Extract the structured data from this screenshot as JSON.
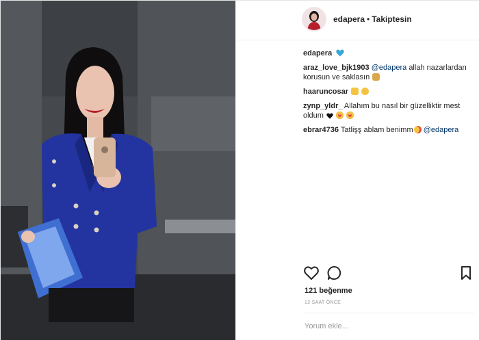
{
  "post": {
    "author": {
      "username": "edapera",
      "separator": "•",
      "follow_status": "Takiptesin"
    },
    "caption": {
      "username": "edapera",
      "emoji": "blue-heart"
    },
    "comments": [
      {
        "username": "araz_love_bjk1903",
        "mention": "@edapera",
        "text": "allah nazarlardan korusun ve saklasın",
        "emojis": [
          "person-bowing"
        ]
      },
      {
        "username": "haaruncosar",
        "text": "",
        "emojis": [
          "thumbs-up",
          "grinning-face"
        ]
      },
      {
        "username": "zynp_yldr_",
        "text": "Allahım bu nasıl bir güzelliktir mest oldum",
        "emojis": [
          "black-heart",
          "heart-eyes",
          "heart-eyes"
        ]
      },
      {
        "username": "ebrar4736",
        "text": "Tatlişş ablam benimm",
        "mention": "@edapera",
        "emojis": [
          "face-blowing-kiss"
        ]
      }
    ],
    "likes": "121 beğenme",
    "time_ago": "12 SAAT ÖNCE",
    "comment_placeholder": "Yorum ekle..."
  },
  "icons": {
    "like": "heart-outline-icon",
    "comment": "speech-bubble-icon",
    "save": "bookmark-icon"
  },
  "colors": {
    "mention": "#003569",
    "text": "#262626",
    "muted": "#999999",
    "blazer": "#2334a0"
  }
}
